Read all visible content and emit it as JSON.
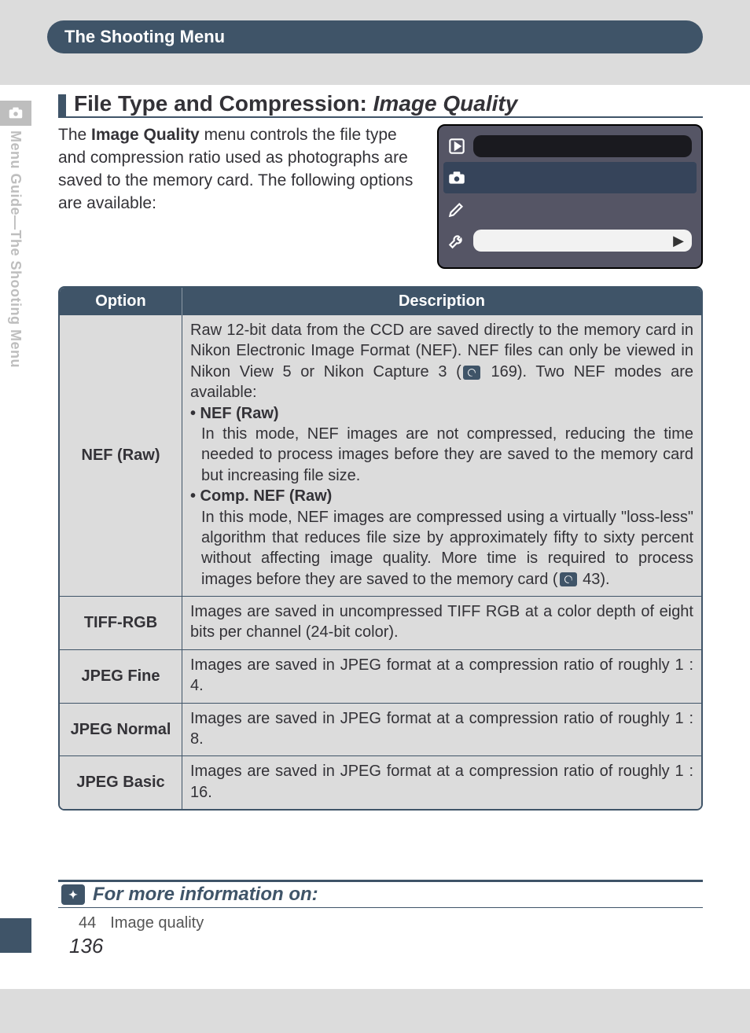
{
  "header": {
    "tab_title": "The Shooting Menu"
  },
  "sidebar": {
    "vertical_text": "Menu Guide—The Shooting Menu"
  },
  "section": {
    "title_prefix": "File Type and Compression: ",
    "title_italic": "Image Quality",
    "intro_pre": "The ",
    "intro_bold": "Image Quality",
    "intro_post": " menu controls the file type and compression ratio used as photographs are saved to the memory card.  The following options are available:"
  },
  "table": {
    "head_option": "Option",
    "head_desc": "Description",
    "rows": [
      {
        "option": "NEF (Raw)",
        "desc_lead": "Raw 12-bit data from the CCD are saved directly to the memory card in Nikon Electronic Image Format (NEF).  NEF files can only be viewed in Nikon View 5 or Nikon Capture 3 (",
        "ref1": " 169).  Two NEF modes are available:",
        "b1_label": "• NEF (Raw)",
        "b1_text": "In this mode, NEF images are not compressed, reducing the time needed to process images before they are saved to the memory card but increasing file size.",
        "b2_label": "• Comp. NEF (Raw)",
        "b2_text_a": "In this mode, NEF images are compressed using a virtually \"loss-less\" algorithm that reduces file size by approximately fifty to sixty percent without affecting image quality.  More time is required to process images before they are saved to the memory card (",
        "b2_text_b": " 43)."
      },
      {
        "option": "TIFF-RGB",
        "desc": "Images are saved in uncompressed TIFF RGB at a color depth of eight bits per channel (24-bit color)."
      },
      {
        "option": "JPEG Fine",
        "desc": "Images are saved in JPEG format at a compression ratio of roughly 1 : 4."
      },
      {
        "option": "JPEG Normal",
        "desc": "Images are saved in JPEG format at a compression ratio of roughly 1 : 8."
      },
      {
        "option": "JPEG Basic",
        "desc": "Images are saved in JPEG format at a compression ratio of roughly 1 : 16."
      }
    ]
  },
  "more_info": {
    "title": "For more information on:",
    "page_ref": "44",
    "topic": "Image quality"
  },
  "page_number": "136"
}
